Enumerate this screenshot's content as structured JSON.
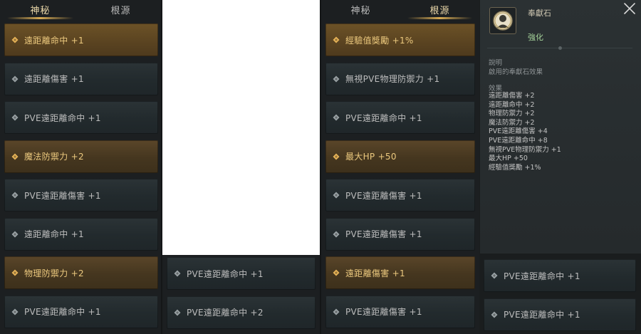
{
  "left_panel": {
    "tabs": [
      {
        "label": "神秘",
        "active": true
      },
      {
        "label": "根源",
        "active": false
      }
    ],
    "rows": [
      {
        "label": "遠距離命中 +1",
        "style": "gold"
      },
      {
        "label": "遠距離傷害 +1",
        "style": "plain"
      },
      {
        "label": "PVE遠距離命中 +1",
        "style": "plain"
      },
      {
        "label": "魔法防禦力 +2",
        "style": "gold"
      },
      {
        "label": "PVE遠距離傷害 +1",
        "style": "plain"
      },
      {
        "label": "遠距離命中 +1",
        "style": "plain"
      },
      {
        "label": "物理防禦力 +2",
        "style": "gold"
      },
      {
        "label": "PVE遠距離命中 +1",
        "style": "plain"
      }
    ]
  },
  "middle_panel": {
    "rows": [
      {
        "label": "PVE遠距離命中 +1",
        "style": "plain"
      },
      {
        "label": "PVE遠距離命中 +2",
        "style": "plain"
      }
    ]
  },
  "right_panel": {
    "tabs": [
      {
        "label": "神秘",
        "active": false
      },
      {
        "label": "根源",
        "active": true
      }
    ],
    "rows": [
      {
        "label": "經驗值獎勵 +1%",
        "style": "gold"
      },
      {
        "label": "無視PVE物理防禦力 +1",
        "style": "plain"
      },
      {
        "label": "PVE遠距離命中 +1",
        "style": "plain"
      },
      {
        "label": "最大HP +50",
        "style": "gold"
      },
      {
        "label": "PVE遠距離傷害 +1",
        "style": "plain"
      },
      {
        "label": "PVE遠距離傷害 +1",
        "style": "plain"
      },
      {
        "label": "遠距離傷害 +1",
        "style": "gold"
      },
      {
        "label": "PVE遠距離傷害 +1",
        "style": "plain"
      }
    ]
  },
  "detail": {
    "item_name": "奉獻石",
    "item_type": "強化",
    "desc_label": "說明",
    "desc_text": "啟用的奉獻石效果",
    "effects_label": "效果",
    "effects": [
      "遠距離傷害 +2",
      "遠距離命中 +2",
      "物理防禦力 +2",
      "魔法防禦力 +2",
      "PVE遠距離傷害 +4",
      "PVE遠距離命中 +8",
      "無視PVE物理防禦力 +1",
      "最大HP +50",
      "經驗值獎勵 +1%"
    ],
    "bottom_rows": [
      {
        "label": "PVE遠距離命中 +1"
      },
      {
        "label": "PVE遠距離命中 +1"
      }
    ]
  },
  "colors": {
    "gold_text": "#ecc97e",
    "plain_text": "#bdbdbd",
    "tab_active_underline": "#d6aa54",
    "item_type": "#a5d39a"
  },
  "icons": {
    "row_bullet": "diamond-icon",
    "close": "close-icon",
    "item": "dedication-stone-icon"
  }
}
